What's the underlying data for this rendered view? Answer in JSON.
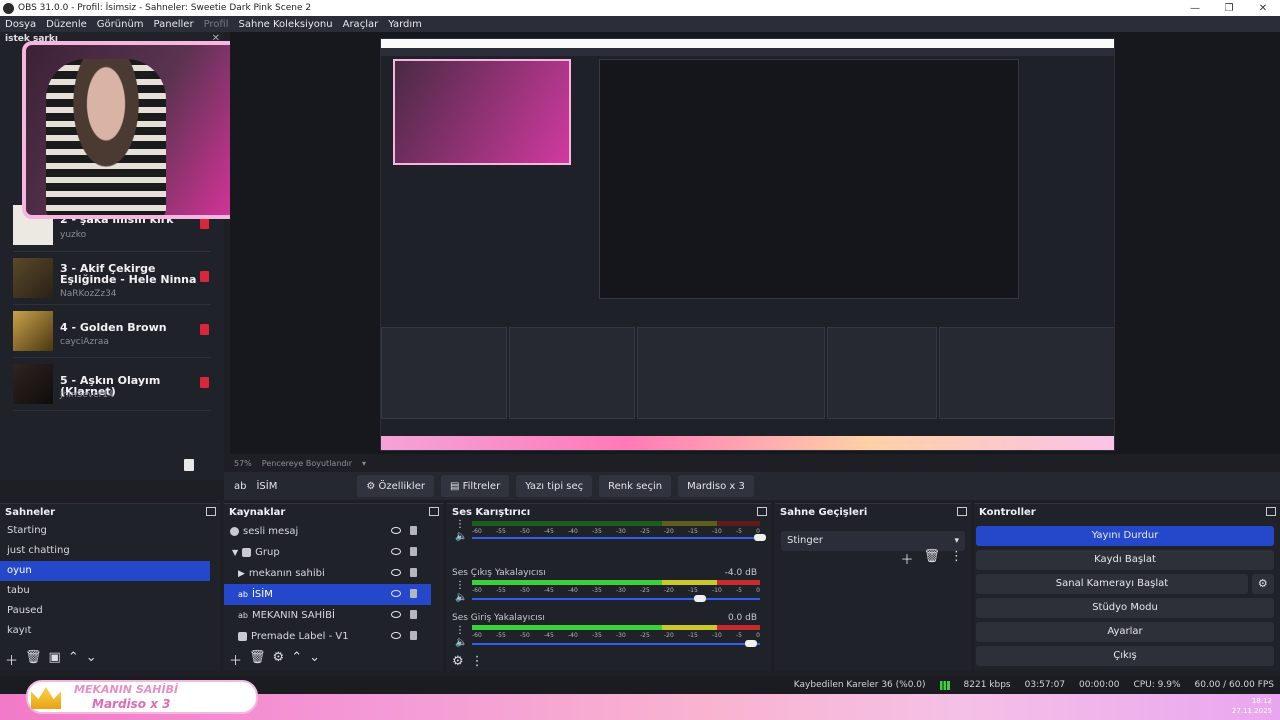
{
  "window": {
    "title": "OBS 31.0.0 - Profil: İsimsiz - Sahneler: Sweetie Dark Pink Scene 2",
    "controls": [
      "—",
      "❐",
      "✕"
    ]
  },
  "menu": [
    "Dosya",
    "Düzenle",
    "Görünüm",
    "Paneller",
    "Profil",
    "Sahne Koleksiyonu",
    "Araçlar",
    "Yardım"
  ],
  "request_dock": {
    "title": "istek şarkı",
    "songs": [
      {
        "title": "2 - şaka mısın kırk",
        "user": "yuzko"
      },
      {
        "title": "3 - Akif Çekirge Eşliğinde - Hele Ninna",
        "user": "NaRKozZz34"
      },
      {
        "title": "4 - Golden Brown",
        "user": "cayciAzraa"
      },
      {
        "title": "5 - Aşkın Olayım (Klarnet)",
        "user": "JhinSever14"
      }
    ]
  },
  "preview": {
    "zoom": "57%",
    "zoom_mode": "Pencereye Boyutlandır"
  },
  "source_toolbar": {
    "source_name": "İSİM",
    "properties": "Özellikler",
    "filters": "Filtreler",
    "font": "Yazı tipi seç",
    "color": "Renk seçin",
    "text": "Mardiso x 3"
  },
  "scenes": {
    "title": "Sahneler",
    "items": [
      "Starting",
      "just chatting",
      "oyun",
      "tabu",
      "Paused",
      "kayıt"
    ],
    "active": "oyun"
  },
  "sources": {
    "title": "Kaynaklar",
    "items": [
      "sesli mesaj",
      "Grup",
      "mekanın sahibi",
      "İSİM",
      "MEKANIN SAHİBİ",
      "Premade Label - V1"
    ],
    "active": "İSİM"
  },
  "mixer": {
    "title": "Ses Karıştırıcı",
    "scale": [
      "-60",
      "-55",
      "-50",
      "-45",
      "-40",
      "-35",
      "-30",
      "-25",
      "-20",
      "-15",
      "-10",
      "-5",
      "0"
    ],
    "channels": [
      {
        "name": "",
        "db": "",
        "level": 0.0,
        "fader": 1.0
      },
      {
        "name": "Ses Çıkış Yakalayıcısı",
        "db": "-4.0 dB",
        "level": 0.78,
        "fader": 0.79
      },
      {
        "name": "Ses Giriş Yakalayıcısı",
        "db": "0.0 dB",
        "level": 0.9,
        "fader": 0.97
      }
    ]
  },
  "transitions": {
    "title": "Sahne Geçişleri",
    "selected": "Stinger"
  },
  "controls": {
    "title": "Kontroller",
    "buttons": [
      "Yayını Durdur",
      "Kaydı Başlat",
      "Sanal Kamerayı Başlat",
      "Stüdyo Modu",
      "Ayarlar",
      "Çıkış"
    ]
  },
  "status": {
    "dropped": "Kaybedilen Kareler 36 (%0.0)",
    "bitrate": "8221 kbps",
    "stream_time": "03:57:07",
    "rec_time": "00:00:00",
    "cpu": "CPU: 9.9%",
    "fps": "60.00 / 60.00 FPS"
  },
  "overlay": {
    "line1": "MEKANIN SAHİBİ",
    "line2": "Mardiso x 3"
  },
  "taskbar": {
    "time": "18:12",
    "date": "27.11.2025"
  },
  "colors": {
    "accent": "#2448c9",
    "pink": "#f7b6e0",
    "danger": "#d8263a"
  }
}
